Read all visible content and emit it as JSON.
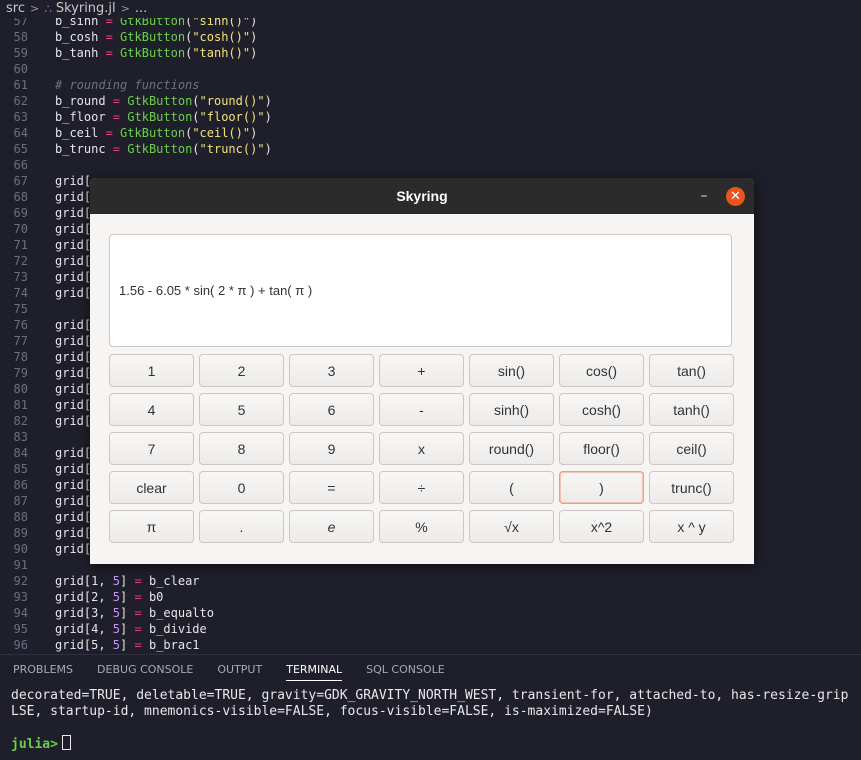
{
  "breadcrumb": {
    "folder": "src",
    "file": "Skyring.jl",
    "more": "..."
  },
  "code_lines": [
    {
      "n": "57",
      "tokens": [
        [
          "v",
          "b_sinh"
        ],
        [
          "o",
          " = "
        ],
        [
          "f",
          "GtkButton"
        ],
        [
          "v",
          "("
        ],
        [
          "s",
          "\"sinh()\""
        ],
        [
          "v",
          ")"
        ]
      ]
    },
    {
      "n": "58",
      "tokens": [
        [
          "v",
          "b_cosh"
        ],
        [
          "o",
          " = "
        ],
        [
          "f",
          "GtkButton"
        ],
        [
          "v",
          "("
        ],
        [
          "s",
          "\"cosh()\""
        ],
        [
          "v",
          ")"
        ]
      ]
    },
    {
      "n": "59",
      "tokens": [
        [
          "v",
          "b_tanh"
        ],
        [
          "o",
          " = "
        ],
        [
          "f",
          "GtkButton"
        ],
        [
          "v",
          "("
        ],
        [
          "s",
          "\"tanh()\""
        ],
        [
          "v",
          ")"
        ]
      ]
    },
    {
      "n": "60",
      "tokens": []
    },
    {
      "n": "61",
      "tokens": [
        [
          "c",
          "# rounding functions"
        ]
      ]
    },
    {
      "n": "62",
      "tokens": [
        [
          "v",
          "b_round"
        ],
        [
          "o",
          " = "
        ],
        [
          "f",
          "GtkButton"
        ],
        [
          "v",
          "("
        ],
        [
          "s",
          "\"round()\""
        ],
        [
          "v",
          ")"
        ]
      ]
    },
    {
      "n": "63",
      "tokens": [
        [
          "v",
          "b_floor"
        ],
        [
          "o",
          " = "
        ],
        [
          "f",
          "GtkButton"
        ],
        [
          "v",
          "("
        ],
        [
          "s",
          "\"floor()\""
        ],
        [
          "v",
          ")"
        ]
      ]
    },
    {
      "n": "64",
      "tokens": [
        [
          "v",
          "b_ceil"
        ],
        [
          "o",
          " = "
        ],
        [
          "f",
          "GtkButton"
        ],
        [
          "v",
          "("
        ],
        [
          "s",
          "\"ceil()\""
        ],
        [
          "v",
          ")"
        ]
      ]
    },
    {
      "n": "65",
      "tokens": [
        [
          "v",
          "b_trunc"
        ],
        [
          "o",
          " = "
        ],
        [
          "f",
          "GtkButton"
        ],
        [
          "v",
          "("
        ],
        [
          "s",
          "\"trunc()\""
        ],
        [
          "v",
          ")"
        ]
      ]
    },
    {
      "n": "66",
      "tokens": []
    },
    {
      "n": "67",
      "tokens": [
        [
          "v",
          "grid["
        ]
      ]
    },
    {
      "n": "68",
      "tokens": [
        [
          "v",
          "grid["
        ]
      ]
    },
    {
      "n": "69",
      "tokens": [
        [
          "v",
          "grid["
        ]
      ]
    },
    {
      "n": "70",
      "tokens": [
        [
          "v",
          "grid["
        ]
      ]
    },
    {
      "n": "71",
      "tokens": [
        [
          "v",
          "grid["
        ]
      ]
    },
    {
      "n": "72",
      "tokens": [
        [
          "v",
          "grid["
        ]
      ]
    },
    {
      "n": "73",
      "tokens": [
        [
          "v",
          "grid["
        ]
      ]
    },
    {
      "n": "74",
      "tokens": [
        [
          "v",
          "grid["
        ]
      ]
    },
    {
      "n": "75",
      "tokens": []
    },
    {
      "n": "76",
      "tokens": [
        [
          "v",
          "grid["
        ]
      ]
    },
    {
      "n": "77",
      "tokens": [
        [
          "v",
          "grid["
        ]
      ]
    },
    {
      "n": "78",
      "tokens": [
        [
          "v",
          "grid["
        ]
      ]
    },
    {
      "n": "79",
      "tokens": [
        [
          "v",
          "grid["
        ]
      ]
    },
    {
      "n": "80",
      "tokens": [
        [
          "v",
          "grid["
        ]
      ]
    },
    {
      "n": "81",
      "tokens": [
        [
          "v",
          "grid["
        ]
      ]
    },
    {
      "n": "82",
      "tokens": [
        [
          "v",
          "grid["
        ]
      ]
    },
    {
      "n": "83",
      "tokens": []
    },
    {
      "n": "84",
      "tokens": [
        [
          "v",
          "grid["
        ]
      ]
    },
    {
      "n": "85",
      "tokens": [
        [
          "v",
          "grid["
        ]
      ]
    },
    {
      "n": "86",
      "tokens": [
        [
          "v",
          "grid["
        ]
      ]
    },
    {
      "n": "87",
      "tokens": [
        [
          "v",
          "grid["
        ]
      ]
    },
    {
      "n": "88",
      "tokens": [
        [
          "v",
          "grid["
        ]
      ]
    },
    {
      "n": "89",
      "tokens": [
        [
          "v",
          "grid["
        ]
      ]
    },
    {
      "n": "90",
      "tokens": [
        [
          "v",
          "grid["
        ]
      ]
    },
    {
      "n": "91",
      "tokens": []
    },
    {
      "n": "92",
      "tokens": [
        [
          "v",
          "grid[1,"
        ],
        [
          "n",
          " 5"
        ],
        [
          "v",
          "]"
        ],
        [
          "o",
          " = "
        ],
        [
          "v",
          "b_clear"
        ]
      ]
    },
    {
      "n": "93",
      "tokens": [
        [
          "v",
          "grid[2,"
        ],
        [
          "n",
          " 5"
        ],
        [
          "v",
          "]"
        ],
        [
          "o",
          " = "
        ],
        [
          "v",
          "b0"
        ]
      ]
    },
    {
      "n": "94",
      "tokens": [
        [
          "v",
          "grid[3,"
        ],
        [
          "n",
          " 5"
        ],
        [
          "v",
          "]"
        ],
        [
          "o",
          " = "
        ],
        [
          "v",
          "b_equalto"
        ]
      ]
    },
    {
      "n": "95",
      "tokens": [
        [
          "v",
          "grid[4,"
        ],
        [
          "n",
          " 5"
        ],
        [
          "v",
          "]"
        ],
        [
          "o",
          " = "
        ],
        [
          "v",
          "b_divide"
        ]
      ]
    },
    {
      "n": "96",
      "tokens": [
        [
          "v",
          "grid[5,"
        ],
        [
          "n",
          " 5"
        ],
        [
          "v",
          "]"
        ],
        [
          "o",
          " = "
        ],
        [
          "v",
          "b_brac1"
        ]
      ]
    }
  ],
  "panel_tabs": [
    {
      "label": "PROBLEMS",
      "active": false
    },
    {
      "label": "DEBUG CONSOLE",
      "active": false
    },
    {
      "label": "OUTPUT",
      "active": false
    },
    {
      "label": "TERMINAL",
      "active": true
    },
    {
      "label": "SQL CONSOLE",
      "active": false
    }
  ],
  "terminal": {
    "line1": "decorated=TRUE, deletable=TRUE, gravity=GDK_GRAVITY_NORTH_WEST, transient-for, attached-to, has-resize-grip",
    "line2": "LSE, startup-id, mnemonics-visible=FALSE, focus-visible=FALSE, is-maximized=FALSE)",
    "prompt": "julia>"
  },
  "window": {
    "title": "Skyring",
    "minimize_glyph": "–",
    "close_glyph": "✕",
    "display_text": "1.56 - 6.05 * sin( 2 * π ) + tan( π )",
    "buttons": [
      [
        "1",
        "2",
        "3",
        "+",
        "sin()",
        "cos()",
        "tan()"
      ],
      [
        "4",
        "5",
        "6",
        "-",
        "sinh()",
        "cosh()",
        "tanh()"
      ],
      [
        "7",
        "8",
        "9",
        "x",
        "round()",
        "floor()",
        "ceil()"
      ],
      [
        "clear",
        "0",
        "=",
        "÷",
        "(",
        ")",
        "trunc()"
      ],
      [
        "π",
        ".",
        "e",
        "%",
        "√x",
        "x^2",
        "x ^ y"
      ]
    ],
    "focused_button": ")"
  },
  "colors": {
    "accent_close": "#e95420",
    "editor_bg": "#1e1f2a",
    "prompt_green": "#6ad04a"
  }
}
